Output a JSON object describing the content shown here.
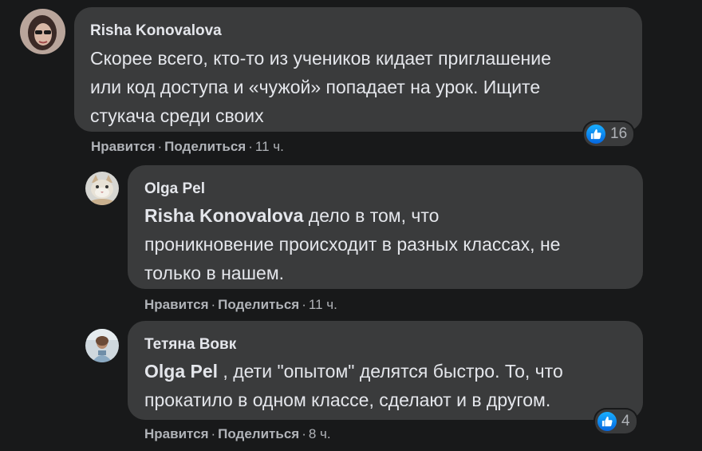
{
  "comments": [
    {
      "author": "Risha Konovalova",
      "lines": [
        "Скорее всего, кто-то из учеников кидает приглашение",
        "или код доступа и «чужой» попадает на урок. Ищите",
        "стукача среди своих"
      ],
      "like_label": "Нравится",
      "share_label": "Поделиться",
      "time": "11 ч.",
      "reaction_count": "16"
    },
    {
      "author": "Olga Pel",
      "mention": "Risha Konovalova",
      "lines": [
        " дело в том, что",
        "проникновение происходит в разных классах, не",
        "только в нашем."
      ],
      "like_label": "Нравится",
      "share_label": "Поделиться",
      "time": "11 ч."
    },
    {
      "author": "Тетяна Вовк",
      "mention": "Olga Pel",
      "lines": [
        " , дети \"опытом\" делятся быстро. То, что",
        "прокатило в одном классе, сделают и в другом."
      ],
      "like_label": "Нравится",
      "share_label": "Поделиться",
      "time": "8 ч.",
      "reaction_count": "4"
    }
  ],
  "separator": "·",
  "colors": {
    "background": "#18191a",
    "bubble": "#3a3b3c",
    "text": "#e4e6eb",
    "secondary_text": "#b0b3b8",
    "like_blue": "#1877f2"
  },
  "icons": {
    "reaction": "like-thumbs-up-icon"
  }
}
